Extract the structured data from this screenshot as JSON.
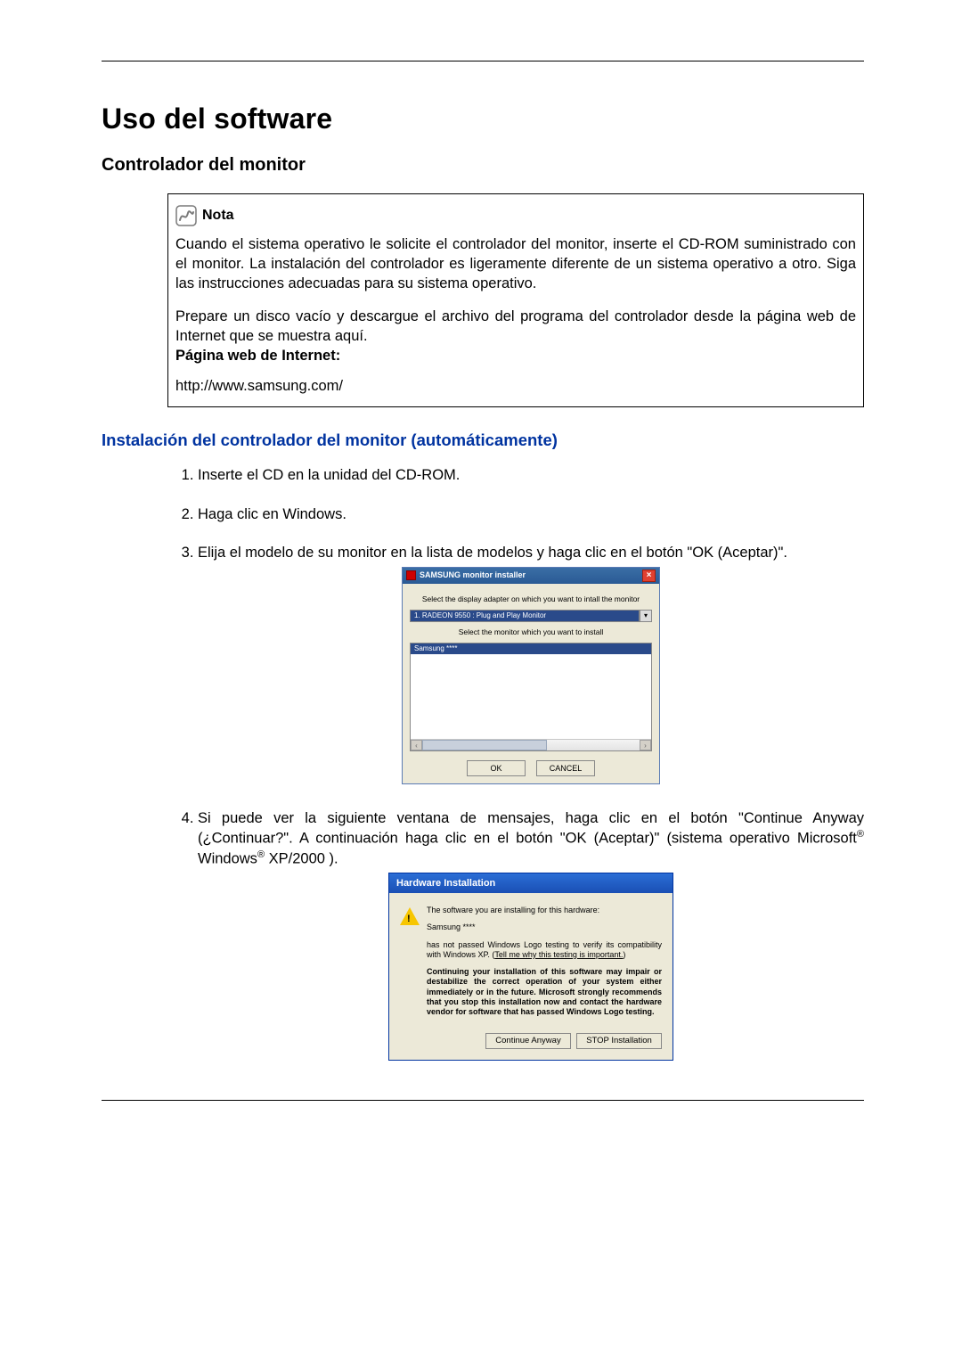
{
  "heading": "Uso del software",
  "section1": "Controlador del monitor",
  "note": {
    "title": "Nota",
    "para1": "Cuando el sistema operativo le solicite el controlador del monitor, inserte el CD-ROM suministrado con el monitor. La instalación del controlador es ligeramente diferente de un sistema operativo a otro. Siga las instrucciones adecuadas para su sistema operativo.",
    "para2": "Prepare un disco vacío y descargue el archivo del programa del controlador desde la página web de Internet que se muestra aquí.",
    "label": "Página web de Internet:",
    "url": "http://www.samsung.com/"
  },
  "section2": "Instalación del controlador del monitor (automáticamente)",
  "steps": {
    "s1": "Inserte el CD en la unidad del CD-ROM.",
    "s2": "Haga clic en Windows.",
    "s3": "Elija el modelo de su monitor en la lista de modelos y haga clic en el botón \"OK (Aceptar)\".",
    "s4_a": "Si puede ver la siguiente ventana de mensajes, haga clic en el botón \"Continue Anyway (¿Continuar?\". A continuación haga clic en el botón \"OK (Aceptar)\" (sistema operativo Microsoft",
    "s4_b": " Windows",
    "s4_c": " XP/2000 ).",
    "reg": "®"
  },
  "installer": {
    "title": "SAMSUNG monitor installer",
    "close": "×",
    "line1": "Select the display adapter on which you want to intall the monitor",
    "combo": "1. RADEON 9550 : Plug and Play Monitor",
    "combo_arrow": "▾",
    "line2": "Select the monitor which you want to install",
    "selected": "Samsung ****",
    "scroll_left": "‹",
    "scroll_right": "›",
    "ok": "OK",
    "cancel": "CANCEL"
  },
  "hw": {
    "title": "Hardware Installation",
    "bang": "!",
    "p1": "The software you are installing for this hardware:",
    "p2": "Samsung ****",
    "p3a": "has not passed Windows Logo testing to verify its compatibility with Windows XP. (",
    "p3link": "Tell me why this testing is important.",
    "p3b": ")",
    "p4": "Continuing your installation of this software may impair or destabilize the correct operation of your system either immediately or in the future. Microsoft strongly recommends that you stop this installation now and contact the hardware vendor for software that has passed Windows Logo testing.",
    "btn_continue": "Continue Anyway",
    "btn_stop": "STOP Installation"
  }
}
